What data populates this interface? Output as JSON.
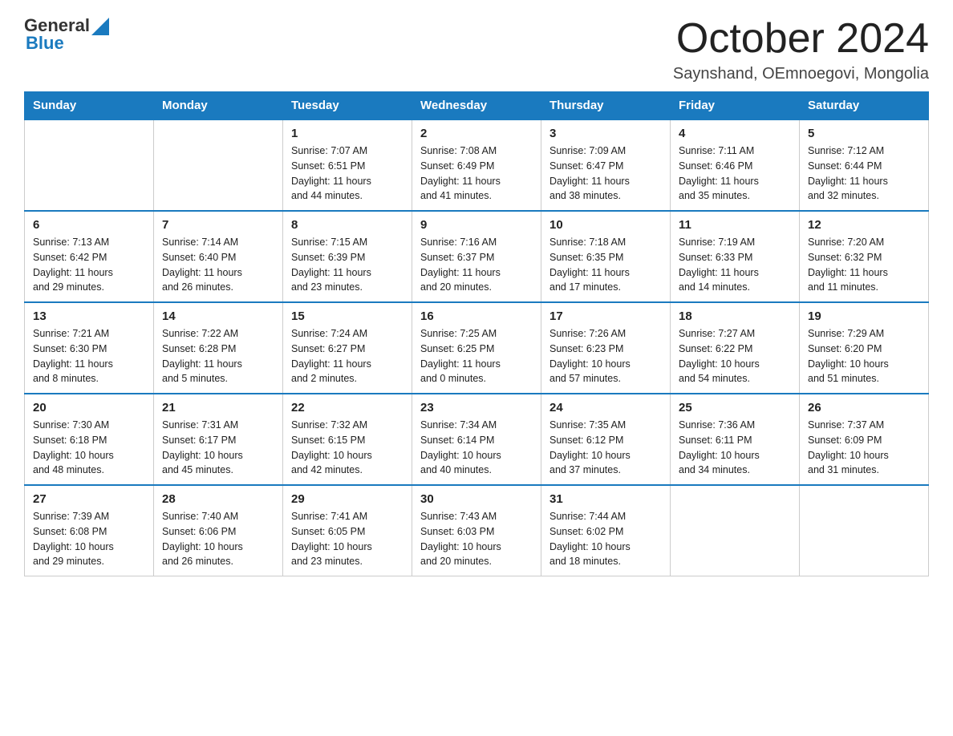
{
  "header": {
    "logo": {
      "general": "General",
      "blue": "Blue"
    },
    "title": "October 2024",
    "subtitle": "Saynshand, OEmnoegovi, Mongolia"
  },
  "calendar": {
    "weekdays": [
      "Sunday",
      "Monday",
      "Tuesday",
      "Wednesday",
      "Thursday",
      "Friday",
      "Saturday"
    ],
    "weeks": [
      [
        {
          "day": "",
          "info": ""
        },
        {
          "day": "",
          "info": ""
        },
        {
          "day": "1",
          "info": "Sunrise: 7:07 AM\nSunset: 6:51 PM\nDaylight: 11 hours\nand 44 minutes."
        },
        {
          "day": "2",
          "info": "Sunrise: 7:08 AM\nSunset: 6:49 PM\nDaylight: 11 hours\nand 41 minutes."
        },
        {
          "day": "3",
          "info": "Sunrise: 7:09 AM\nSunset: 6:47 PM\nDaylight: 11 hours\nand 38 minutes."
        },
        {
          "day": "4",
          "info": "Sunrise: 7:11 AM\nSunset: 6:46 PM\nDaylight: 11 hours\nand 35 minutes."
        },
        {
          "day": "5",
          "info": "Sunrise: 7:12 AM\nSunset: 6:44 PM\nDaylight: 11 hours\nand 32 minutes."
        }
      ],
      [
        {
          "day": "6",
          "info": "Sunrise: 7:13 AM\nSunset: 6:42 PM\nDaylight: 11 hours\nand 29 minutes."
        },
        {
          "day": "7",
          "info": "Sunrise: 7:14 AM\nSunset: 6:40 PM\nDaylight: 11 hours\nand 26 minutes."
        },
        {
          "day": "8",
          "info": "Sunrise: 7:15 AM\nSunset: 6:39 PM\nDaylight: 11 hours\nand 23 minutes."
        },
        {
          "day": "9",
          "info": "Sunrise: 7:16 AM\nSunset: 6:37 PM\nDaylight: 11 hours\nand 20 minutes."
        },
        {
          "day": "10",
          "info": "Sunrise: 7:18 AM\nSunset: 6:35 PM\nDaylight: 11 hours\nand 17 minutes."
        },
        {
          "day": "11",
          "info": "Sunrise: 7:19 AM\nSunset: 6:33 PM\nDaylight: 11 hours\nand 14 minutes."
        },
        {
          "day": "12",
          "info": "Sunrise: 7:20 AM\nSunset: 6:32 PM\nDaylight: 11 hours\nand 11 minutes."
        }
      ],
      [
        {
          "day": "13",
          "info": "Sunrise: 7:21 AM\nSunset: 6:30 PM\nDaylight: 11 hours\nand 8 minutes."
        },
        {
          "day": "14",
          "info": "Sunrise: 7:22 AM\nSunset: 6:28 PM\nDaylight: 11 hours\nand 5 minutes."
        },
        {
          "day": "15",
          "info": "Sunrise: 7:24 AM\nSunset: 6:27 PM\nDaylight: 11 hours\nand 2 minutes."
        },
        {
          "day": "16",
          "info": "Sunrise: 7:25 AM\nSunset: 6:25 PM\nDaylight: 11 hours\nand 0 minutes."
        },
        {
          "day": "17",
          "info": "Sunrise: 7:26 AM\nSunset: 6:23 PM\nDaylight: 10 hours\nand 57 minutes."
        },
        {
          "day": "18",
          "info": "Sunrise: 7:27 AM\nSunset: 6:22 PM\nDaylight: 10 hours\nand 54 minutes."
        },
        {
          "day": "19",
          "info": "Sunrise: 7:29 AM\nSunset: 6:20 PM\nDaylight: 10 hours\nand 51 minutes."
        }
      ],
      [
        {
          "day": "20",
          "info": "Sunrise: 7:30 AM\nSunset: 6:18 PM\nDaylight: 10 hours\nand 48 minutes."
        },
        {
          "day": "21",
          "info": "Sunrise: 7:31 AM\nSunset: 6:17 PM\nDaylight: 10 hours\nand 45 minutes."
        },
        {
          "day": "22",
          "info": "Sunrise: 7:32 AM\nSunset: 6:15 PM\nDaylight: 10 hours\nand 42 minutes."
        },
        {
          "day": "23",
          "info": "Sunrise: 7:34 AM\nSunset: 6:14 PM\nDaylight: 10 hours\nand 40 minutes."
        },
        {
          "day": "24",
          "info": "Sunrise: 7:35 AM\nSunset: 6:12 PM\nDaylight: 10 hours\nand 37 minutes."
        },
        {
          "day": "25",
          "info": "Sunrise: 7:36 AM\nSunset: 6:11 PM\nDaylight: 10 hours\nand 34 minutes."
        },
        {
          "day": "26",
          "info": "Sunrise: 7:37 AM\nSunset: 6:09 PM\nDaylight: 10 hours\nand 31 minutes."
        }
      ],
      [
        {
          "day": "27",
          "info": "Sunrise: 7:39 AM\nSunset: 6:08 PM\nDaylight: 10 hours\nand 29 minutes."
        },
        {
          "day": "28",
          "info": "Sunrise: 7:40 AM\nSunset: 6:06 PM\nDaylight: 10 hours\nand 26 minutes."
        },
        {
          "day": "29",
          "info": "Sunrise: 7:41 AM\nSunset: 6:05 PM\nDaylight: 10 hours\nand 23 minutes."
        },
        {
          "day": "30",
          "info": "Sunrise: 7:43 AM\nSunset: 6:03 PM\nDaylight: 10 hours\nand 20 minutes."
        },
        {
          "day": "31",
          "info": "Sunrise: 7:44 AM\nSunset: 6:02 PM\nDaylight: 10 hours\nand 18 minutes."
        },
        {
          "day": "",
          "info": ""
        },
        {
          "day": "",
          "info": ""
        }
      ]
    ]
  }
}
